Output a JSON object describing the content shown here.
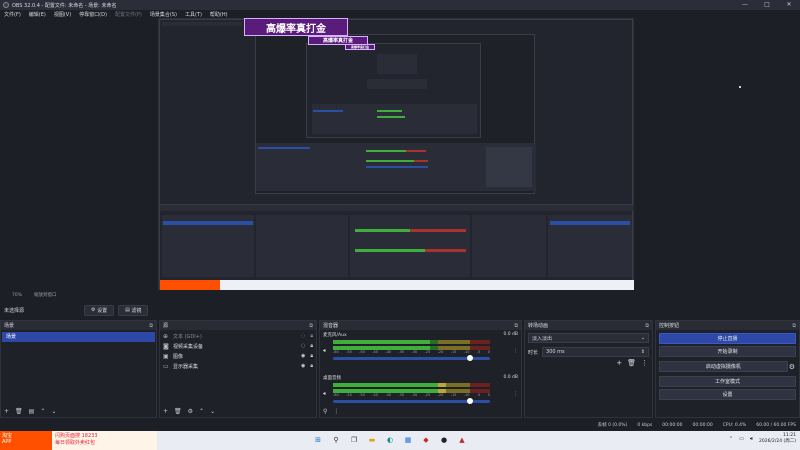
{
  "window": {
    "title": "OBS 32.0.4 - 配置文件: 未命名 - 场景: 未命名",
    "minimize": "—",
    "maximize": "□",
    "close": "✕"
  },
  "menu": [
    "文件(F)",
    "编辑(E)",
    "视图(V)",
    "停靠窗口(D)",
    "配置文件(P)",
    "场景集合(S)",
    "工具(T)",
    "帮助(H)"
  ],
  "banner": {
    "text": "高爆率真打金",
    "small_text": "高爆率真打金",
    "tiny_text": "高爆率真打金"
  },
  "zoom": {
    "value": "70%",
    "mode": "缩放到窗口"
  },
  "preview_controls": {
    "scene_label": "未选择源",
    "settings_button": "设置",
    "filters_button": "滤镜"
  },
  "scenes_dock": {
    "title": "场景",
    "items": [
      "场景"
    ]
  },
  "sources_dock": {
    "title": "源",
    "items": [
      {
        "icon": "text-icon",
        "label": "文本 (GDI+)"
      },
      {
        "icon": "camera-icon",
        "label": "视频采集设备"
      },
      {
        "icon": "image-icon",
        "label": "图像"
      },
      {
        "icon": "monitor-icon",
        "label": "显示器采集"
      }
    ]
  },
  "mixer_dock": {
    "title": "混音器",
    "channels": [
      {
        "name": "麦克风/Aux",
        "db": "0.0 dB",
        "level": 0.62,
        "volume": 0.87
      },
      {
        "name": "桌面音频",
        "db": "0.0 dB",
        "level": 0.72,
        "volume": 0.87
      }
    ],
    "scale": [
      "-60",
      "-55",
      "-50",
      "-45",
      "-40",
      "-35",
      "-30",
      "-25",
      "-20",
      "-15",
      "-10",
      "-5",
      "0"
    ]
  },
  "transitions_dock": {
    "title": "转场动画",
    "transition": "淡入淡出",
    "duration_label": "时长",
    "duration": "300 ms"
  },
  "controls_dock": {
    "title": "控制按钮",
    "buttons": [
      "停止直播",
      "开始录制",
      "启动虚拟摄像机",
      "工作室模式",
      "设置"
    ]
  },
  "status": {
    "dropped": "丢帧 0 (0.0%)",
    "bitrate": "0 kbps",
    "stream_time": "00:00:00",
    "rec_time": "00:00:00",
    "cpu": "CPU: 0.4%",
    "fps": "60.00 / 60.00 FPS"
  },
  "taskbar": {
    "ad_line1": "淘宝",
    "ad_line2": "APP",
    "promo_line1": "闪购页面搜 18233",
    "promo_line2": "每日领取外卖红包",
    "time": "11:21",
    "date": "2026/2/24 (周二)"
  },
  "colors": {
    "accent": "#2e48a8",
    "meter_green": "#3fae3a",
    "meter_yellow": "#b9a83a",
    "meter_red": "#a8322d",
    "banner": "#5a1c7a"
  }
}
